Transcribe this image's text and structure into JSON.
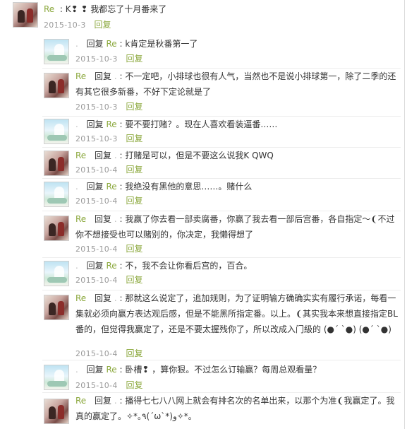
{
  "top": {
    "user": "Re",
    "text": "K❢ ❢ 我都忘了十月番来了",
    "date": "2015-10-3",
    "reply_label": "回复"
  },
  "replies": [
    {
      "avatar": "a",
      "author": ".",
      "verb": "回复",
      "target": "Re",
      "sep": ":",
      "text": "k肯定是秋番第一了",
      "date": "2015-10-3",
      "reply": "回复"
    },
    {
      "avatar": "b",
      "author": "Re",
      "verb": "回复",
      "target": ".",
      "sep": ":",
      "text": "不一定吧，小排球也很有人气，当然也不是说小排球第一，除了二季的还有其它很多新番，不好下定论就是了",
      "date": "2015-10-3",
      "reply": "回复"
    },
    {
      "avatar": "a",
      "author": ".",
      "verb": "回复",
      "target": "Re",
      "sep": ":",
      "text": "要不要打赌？。现在人喜欢看装逼番……",
      "date": "2015-10-3",
      "reply": "回复"
    },
    {
      "avatar": "b",
      "author": "Re",
      "verb": "回复",
      "target": ".",
      "sep": ":",
      "text": "打赌是可以，但是不要这么说我K QWQ",
      "date": "2015-10-4",
      "reply": "回复"
    },
    {
      "avatar": "a",
      "author": ".",
      "verb": "回复",
      "target": "Re",
      "sep": ":",
      "text": "我绝没有黑他的意思……。赌什么",
      "date": "2015-10-4",
      "reply": "回复"
    },
    {
      "avatar": "b",
      "author": "Re",
      "verb": "回复",
      "target": ".",
      "sep": ":",
      "text": "我赢了你去看一部卖腐番，你赢了我去看一部后宫番，各自指定～❨不过你不想接受也可以赌别的，你决定，我懒得想了",
      "date": "2015-10-4",
      "reply": "回复"
    },
    {
      "avatar": "a",
      "author": ".",
      "verb": "回复",
      "target": "Re",
      "sep": ":",
      "text": "不，我不会让你看后宫的，百合。",
      "date": "2015-10-4",
      "reply": "回复"
    },
    {
      "avatar": "b",
      "author": "Re",
      "verb": "回复",
      "target": ".",
      "sep": ":",
      "text": "那就这么说定了，追加规则，为了证明输方确确实实有履行承诺，每看一集就必须向赢方表达观后感，但是不能黑所指定番。以上。❨其实我本来想直接指定BL番的，但觉得我赢定了，还是不要太握残你了，所以改成入门級的    (●´  `●)      (●´  `●)",
      "date": "2015-10-4",
      "reply": "回复"
    },
    {
      "avatar": "a",
      "author": ".",
      "verb": "回复",
      "target": "Re",
      "sep": ":",
      "text": "卧槽❢ ，算你狠。不过怎么订输赢？每周总观看量？",
      "date": "2015-10-4",
      "reply": "回复"
    },
    {
      "avatar": "b",
      "author": "Re",
      "verb": "回复",
      "target": ".",
      "sep": ":",
      "text": "播得七七八八网上就会有排名次的名单出来，以那个为准❨我赢定了。我真的赢定了。✧*｡٩(ˊωˋ*)و✧*｡",
      "date": "",
      "reply": ""
    }
  ]
}
